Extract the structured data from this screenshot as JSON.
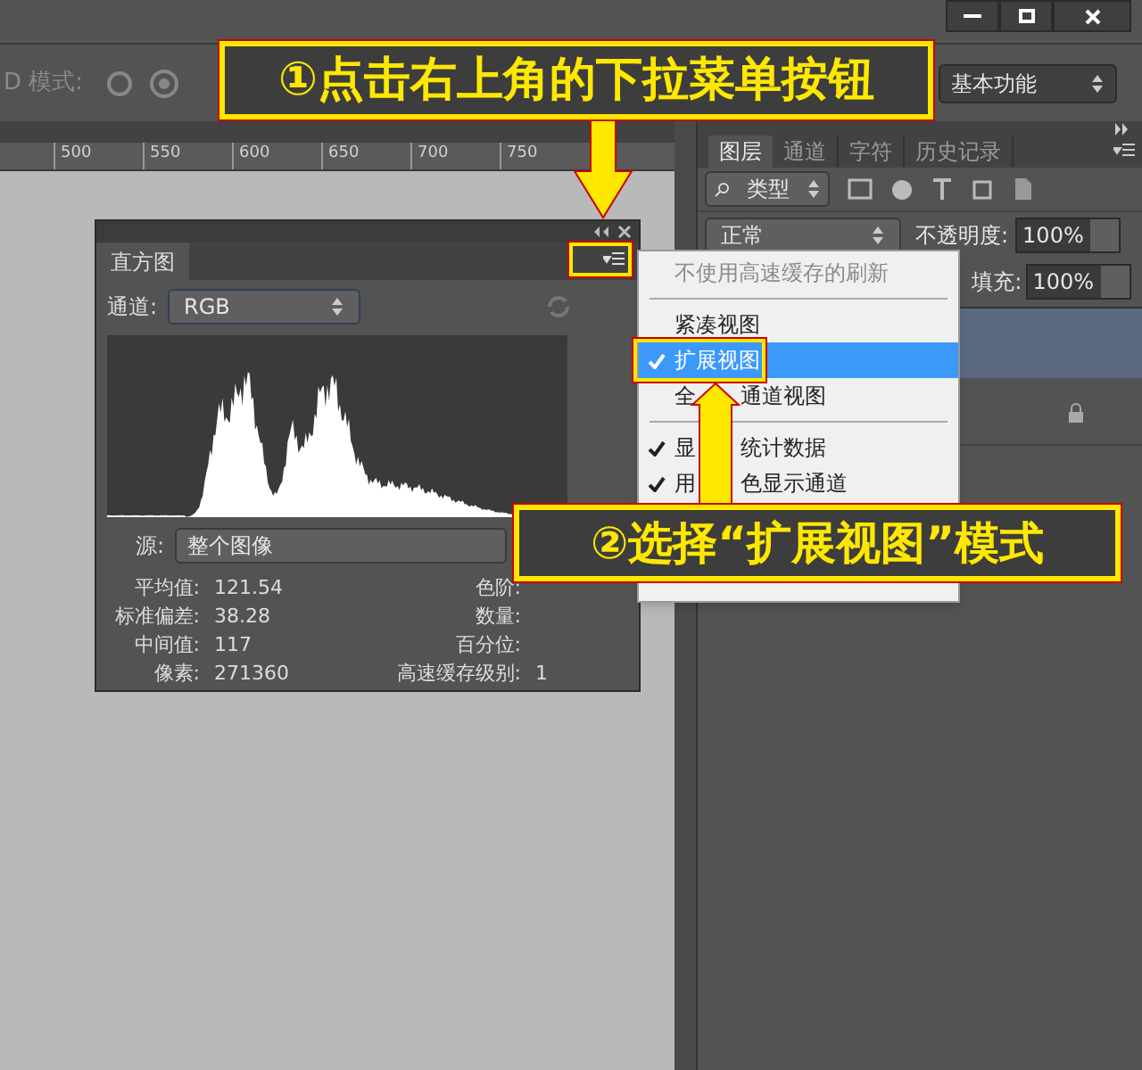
{
  "options_bar": {
    "mode_label": "D 模式:",
    "workspace": "基本功能"
  },
  "ruler": {
    "ticks": [
      "500",
      "550",
      "600",
      "650",
      "700",
      "750"
    ]
  },
  "histogram_panel": {
    "tab": "直方图",
    "channel_label": "通道:",
    "channel": "RGB",
    "source_label": "源:",
    "source": "整个图像",
    "stats": [
      {
        "label": "平均值:",
        "value": "121.54",
        "label_2": "色阶:"
      },
      {
        "label": "标准偏差:",
        "value": "38.28",
        "label_2": "数量:"
      },
      {
        "label": "中间值:",
        "value": "117",
        "label_2": "百分位:"
      },
      {
        "label": "像素:",
        "value": "271360",
        "label_2": "高速缓存级别:",
        "value_2": "1"
      }
    ]
  },
  "panel_menu": [
    {
      "kind": "item",
      "label": "不使用高速缓存的刷新",
      "disabled": true,
      "checked": false,
      "selected": false
    },
    {
      "kind": "separator"
    },
    {
      "kind": "item",
      "label": "紧凑视图",
      "disabled": false,
      "checked": false,
      "selected": false
    },
    {
      "kind": "item",
      "label": "扩展视图",
      "disabled": false,
      "checked": true,
      "selected": true
    },
    {
      "kind": "item",
      "parts": [
        "全",
        "通道视图"
      ],
      "disabled": false,
      "checked": false,
      "selected": false
    },
    {
      "kind": "separator"
    },
    {
      "kind": "item",
      "parts": [
        "显",
        "统计数据"
      ],
      "disabled": false,
      "checked": true,
      "selected": false
    },
    {
      "kind": "item",
      "parts": [
        "用",
        "色显示通道"
      ],
      "disabled": false,
      "checked": true,
      "selected": false
    }
  ],
  "layers_panel": {
    "tabs": [
      {
        "label": "图层",
        "selected": true
      },
      {
        "label": "通道",
        "selected": false
      },
      {
        "label": "字符",
        "selected": false
      },
      {
        "label": "历史记录",
        "selected": false
      }
    ],
    "filter": "类型",
    "blend_mode": "正常",
    "opacity_label": "不透明度:",
    "opacity": "100%",
    "fill_label": "填充:",
    "fill": "100%"
  },
  "annotations": [
    {
      "text": "①点击右上角的下拉菜单按钮"
    },
    {
      "text": "②选择“扩展视图”模式"
    }
  ]
}
